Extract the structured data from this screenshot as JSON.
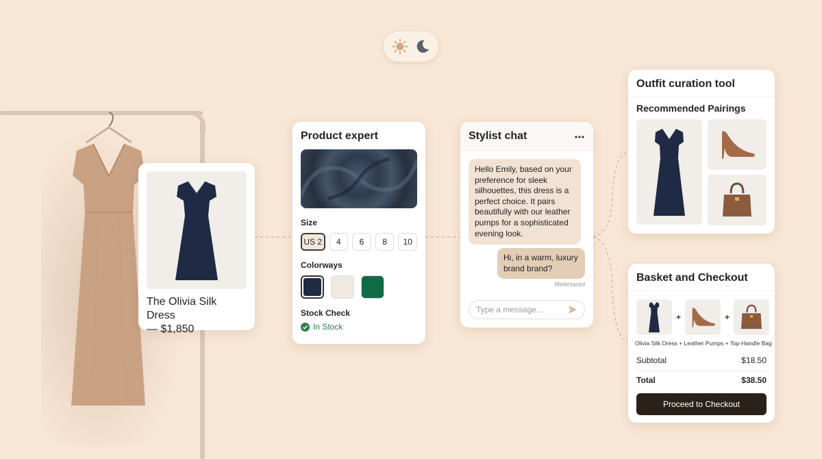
{
  "theme_toggle": {
    "light_icon": "sun-icon",
    "dark_icon": "moon-icon"
  },
  "product_card": {
    "name": "The Olivia Silk Dress",
    "price": "— $1,850"
  },
  "product_expert": {
    "title": "Product expert",
    "size_label": "Size",
    "sizes": [
      "US 2",
      "4",
      "6",
      "8",
      "10"
    ],
    "selected_size": "US 2",
    "colorways_label": "Colorways",
    "colorways": [
      "#1f2a44",
      "#efe9e0",
      "#0f6b45"
    ],
    "stock_label": "Stock Check",
    "stock_status": "In Stock"
  },
  "stylist_chat": {
    "title": "Stylist chat",
    "incoming_message": "Hello Emily, based on your preference for sleek silhouettes, this dress is a perfect choice. It pairs beautifully with our leather pumps for a sophisticated evening look.",
    "outgoing_message": "Hi, in a warm, luxury brand brand?",
    "meta": "Meitirsared",
    "input_placeholder": "Type a message..."
  },
  "outfit_tool": {
    "title": "Outfit curation tool",
    "subtitle": "Recommended Pairings"
  },
  "basket": {
    "title": "Basket and Checkout",
    "items_description": "Olivia Silk Dress + Leather Pumps + Top-Handle Bag",
    "subtotal_label": "Subtotal",
    "subtotal_value": "$18.50",
    "total_label": "Total",
    "total_value": "$38.50",
    "checkout_label": "Proceed to Checkout"
  },
  "colors": {
    "background": "#f8e6d6",
    "dress_beige": "#c9a284",
    "dress_navy": "#1f2a44",
    "accent_chat_in": "#f1e2d4",
    "accent_chat_out": "#e4cdb7",
    "button_dark": "#2a211b",
    "stock_green": "#2e7d4f"
  }
}
